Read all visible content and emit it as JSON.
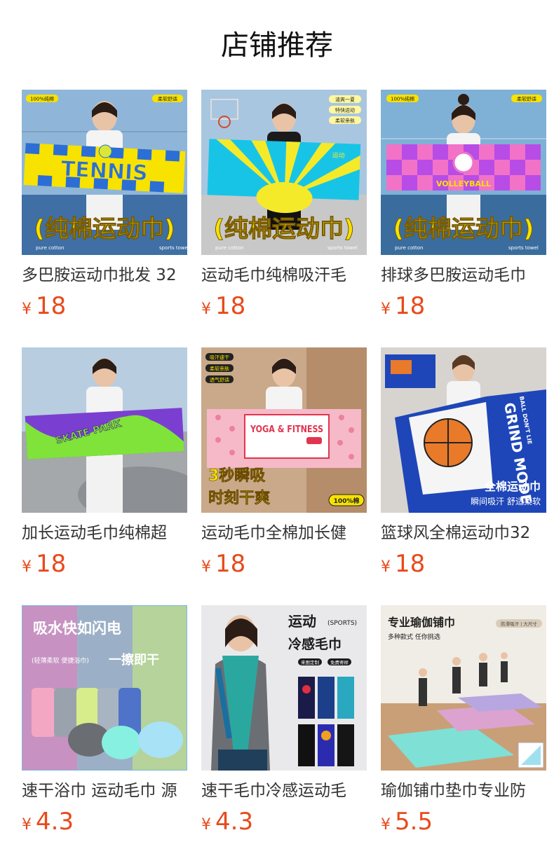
{
  "page": {
    "title": "店铺推荐"
  },
  "currency": "¥",
  "products": [
    {
      "name": "多巴胺运动巾批发 32",
      "price": "18",
      "image": {
        "bg": "#8fb6d8",
        "towel_a": "#f7e200",
        "towel_b": "#2b6fd6",
        "big_text": "TENNIS",
        "badges": [
          "100%纯棉",
          "柔软舒适"
        ],
        "overlay": "(纯棉运动巾)",
        "footer": [
          "pure cotton",
          "sports towel"
        ]
      }
    },
    {
      "name": "运动毛巾纯棉吸汗毛",
      "price": "18",
      "image": {
        "bg": "#a9c6e0",
        "towel_a": "#18c4e6",
        "towel_b": "#f5ea2a",
        "big_text": "运动",
        "badges": [
          "清爽一夏",
          "特快运动",
          "柔软亲肤"
        ],
        "overlay": "(纯棉运动巾)",
        "footer": [
          "pure cotton",
          "sports towel"
        ]
      }
    },
    {
      "name": "排球多巴胺运动毛巾",
      "price": "18",
      "image": {
        "bg": "#7fb0d6",
        "towel_a": "#b84ce6",
        "towel_b": "#f272c8",
        "big_text": "VOLLEYBALL",
        "badges": [
          "100%纯棉",
          "柔软舒适"
        ],
        "overlay": "(纯棉运动巾)",
        "footer": [
          "pure cotton",
          "sports towel"
        ]
      }
    },
    {
      "name": "加长运动毛巾纯棉超",
      "price": "18",
      "image": {
        "bg": "#b8cde0",
        "towel_a": "#7a3fd0",
        "towel_b": "#7fe33a",
        "big_text": "SKATE PARK"
      }
    },
    {
      "name": "运动毛巾全棉加长健",
      "price": "18",
      "image": {
        "bg": "#c9a98a",
        "towel_a": "#f6b9c8",
        "towel_b": "#e0354f",
        "big_text": "YOGA & FITNESS",
        "badges": [
          "吸汗速干",
          "柔软亲肤",
          "透气舒适"
        ],
        "promo": [
          "3秒瞬吸",
          "时刻干爽"
        ],
        "tag": "100%棉"
      }
    },
    {
      "name": "篮球风全棉运动巾32",
      "price": "18",
      "image": {
        "bg": "#d7d4cf",
        "towel_a": "#1e46b8",
        "towel_b": "#f5f5f5",
        "big_text": "GRIND MODE",
        "sub_text": "BALL DON'T LIE",
        "caption": [
          "全棉运动巾",
          "瞬间吸汗 舒适柔软"
        ]
      }
    },
    {
      "name": "速干浴巾 运动毛巾 源",
      "price": "4.3",
      "image": {
        "bg": "#9bb0c6",
        "headline": "吸水快如闪电",
        "subline": "(轻薄柔软 便捷浴巾)",
        "slogan": "一擦即干"
      }
    },
    {
      "name": "速干毛巾冷感运动毛",
      "price": "4.3",
      "image": {
        "bg": "#e9e9eb",
        "headline": "运动",
        "tag": "(SPORTS)",
        "subline": "冷感毛巾",
        "chips": [
          "来图定制",
          "免费寄样"
        ]
      }
    },
    {
      "name": "瑜伽铺巾垫巾专业防",
      "price": "5.5",
      "image": {
        "bg": "#f0ece6",
        "headline": "专业瑜伽铺巾",
        "subline": "多种款式 任你挑选",
        "chip": "防滑吸汗 | 大尺寸"
      }
    }
  ]
}
